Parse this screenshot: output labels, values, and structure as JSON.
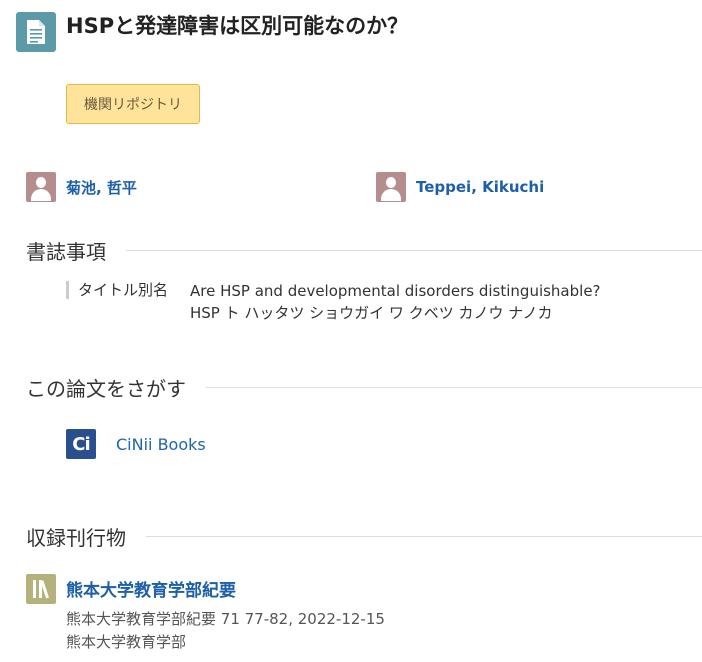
{
  "header": {
    "icon": "document-icon",
    "title": "HSPと発達障害は区別可能なのか？"
  },
  "repository_badge": {
    "label": "機関リポジトリ",
    "color": "#fde49a"
  },
  "authors": [
    {
      "name": "菊池, 哲平",
      "icon": "person-icon"
    },
    {
      "name": "Teppei, Kikuchi",
      "icon": "person-icon"
    }
  ],
  "bibliography": {
    "heading": "書誌事項",
    "rows": [
      {
        "key": "タイトル別名",
        "values": [
          "Are HSP and developmental disorders distinguishable?",
          "HSP ト ハッタツ ショウガイ ワ クベツ カノウ ナノカ"
        ]
      }
    ]
  },
  "search": {
    "heading": "この論文をさがす",
    "links": [
      {
        "icon_text": "Ci",
        "label": "CiNii Books"
      }
    ]
  },
  "journal": {
    "heading": "収録刊行物",
    "name": "熊本大学教育学部紀要",
    "citation": "熊本大学教育学部紀要 71 77-82, 2022-12-15",
    "publisher": "熊本大学教育学部"
  },
  "colors": {
    "link": "#1d5fa8",
    "doc_icon": "#5b9aa6",
    "avatar": "#b58d8d",
    "cinii": "#2a4f8f",
    "journal_icon": "#b4b27a"
  }
}
